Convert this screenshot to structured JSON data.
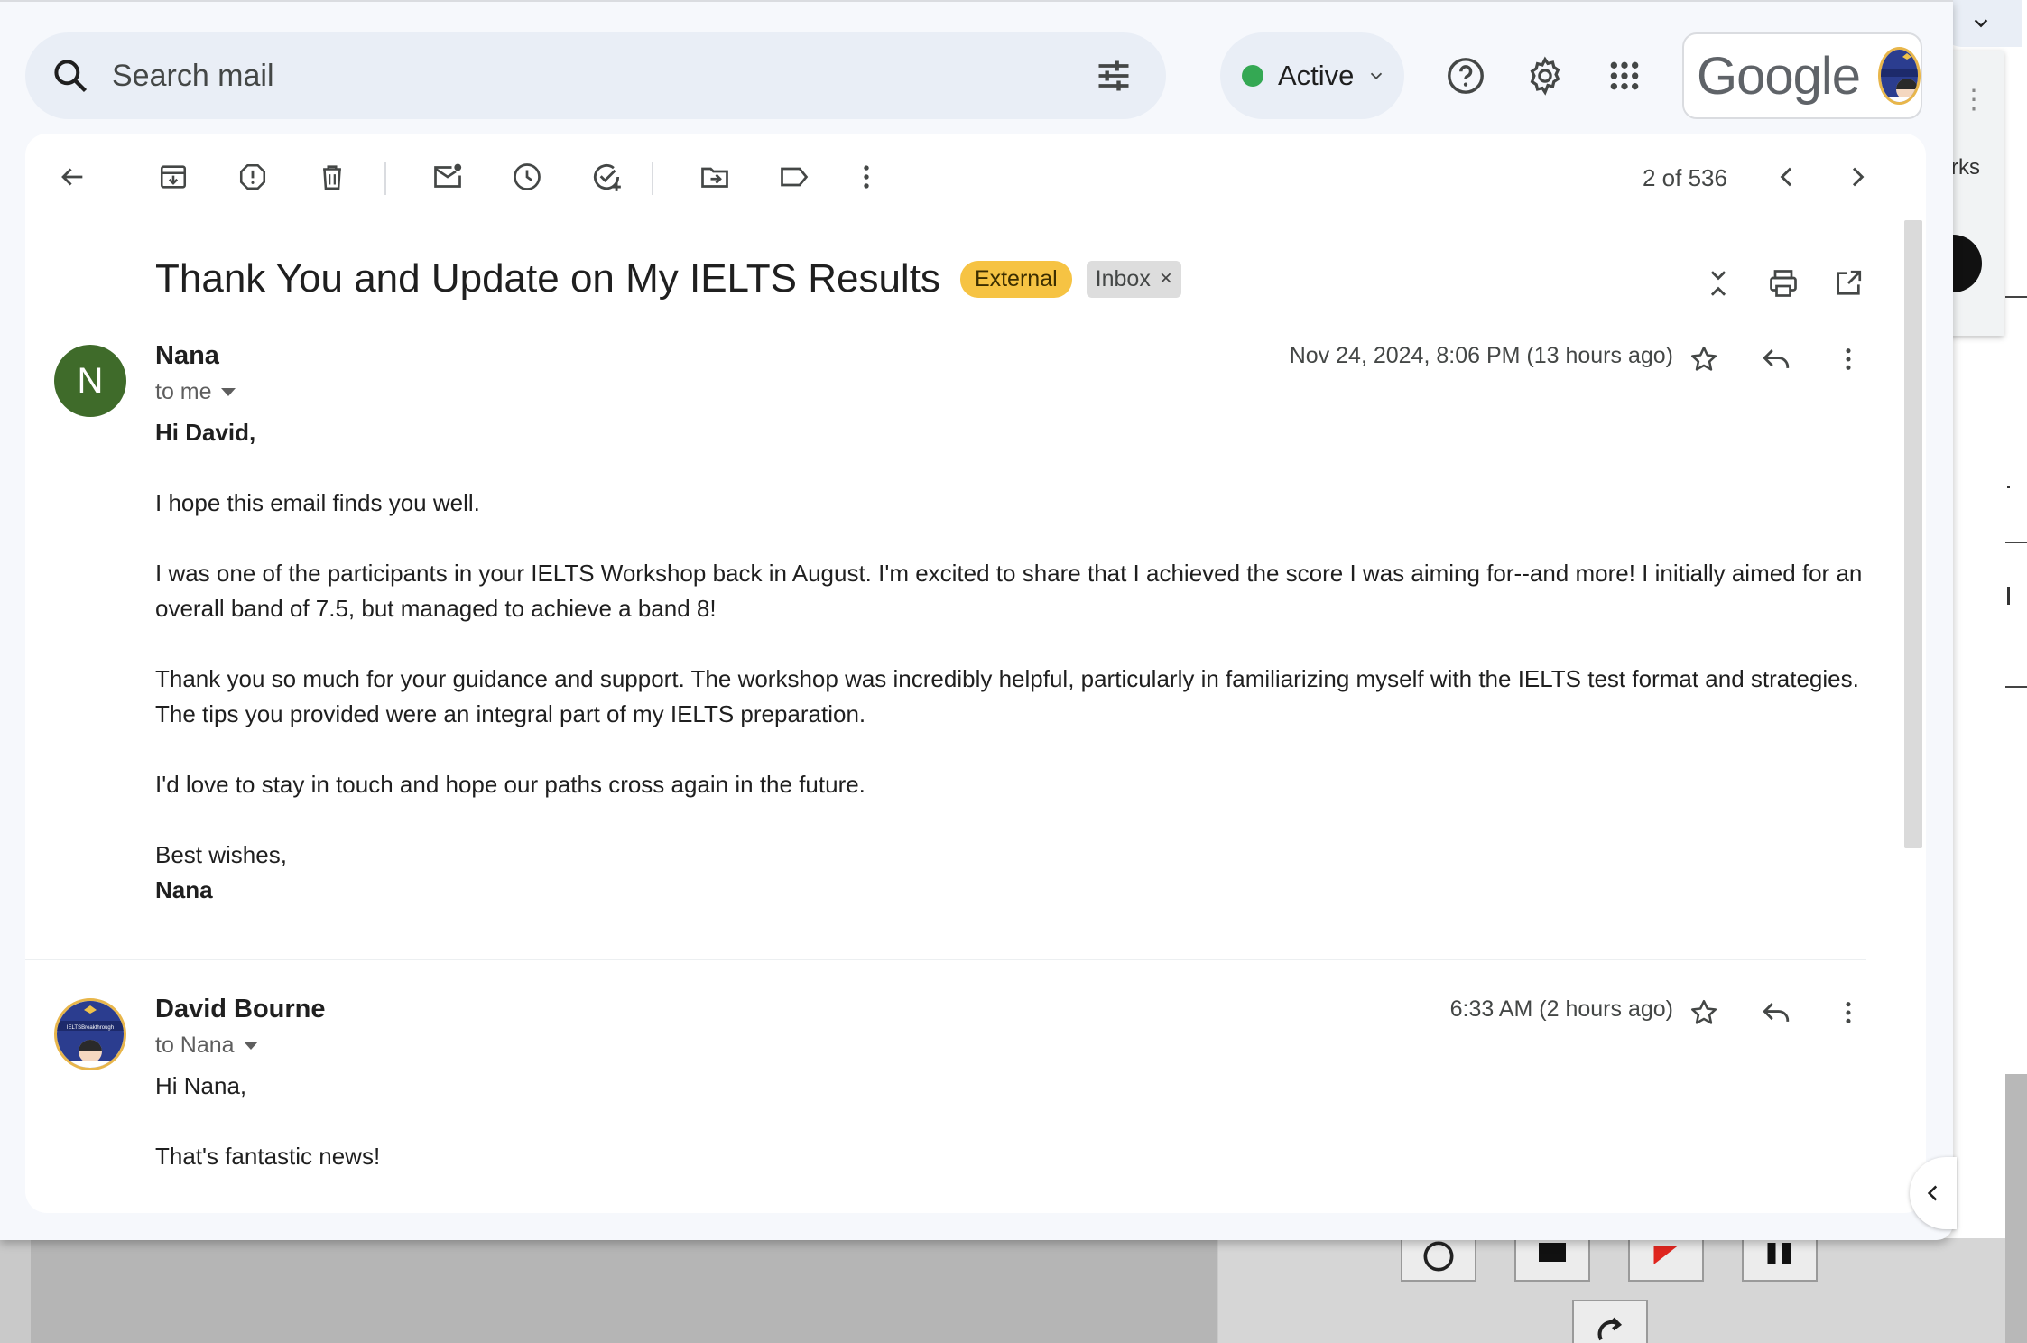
{
  "search": {
    "placeholder": "Search mail"
  },
  "status": {
    "label": "Active",
    "color": "#34a853"
  },
  "brand": {
    "logo_text": "Google"
  },
  "toolbar": {
    "pagination": "2 of 536",
    "icons": [
      "back-arrow-icon",
      "archive-icon",
      "report-spam-icon",
      "delete-icon",
      "mark-unread-icon",
      "snooze-icon",
      "add-task-icon",
      "move-to-icon",
      "label-icon",
      "more-icon",
      "newer-icon",
      "older-icon"
    ]
  },
  "thread": {
    "subject": "Thank You and Update on My IELTS Results",
    "external_badge": "External",
    "label_chip": "Inbox",
    "label_remove": "×"
  },
  "messages": [
    {
      "sender": "Nana",
      "avatar_letter": "N",
      "avatar_color": "#3f6b2a",
      "recipient": "to me",
      "date": "Nov 24, 2024, 8:06 PM (13 hours ago)",
      "body": [
        "Hi David,",
        "I hope this email finds you well.",
        "I was one of the participants in your IELTS Workshop back in August. I'm excited to share that I achieved the score I was aiming for--and more! I initially aimed for an overall band of 7.5, but managed to achieve a band 8!",
        "Thank you so much for your guidance and support. The workshop was incredibly helpful, particularly in familiarizing myself with the IELTS test format and strategies. The tips you provided were an integral part of my IELTS preparation.",
        "I'd love to stay in touch and hope our paths cross again in the future."
      ],
      "signoff": "Best wishes,",
      "signature": "Nana"
    },
    {
      "sender": "David Bourne",
      "recipient": "to Nana",
      "date": "6:33 AM (2 hours ago)",
      "body": [
        "Hi Nana,",
        "That's fantastic news!"
      ]
    }
  ],
  "avatar_logo_text": "IELTSBreakthrough",
  "background_app": {
    "partial_text": "rks"
  }
}
